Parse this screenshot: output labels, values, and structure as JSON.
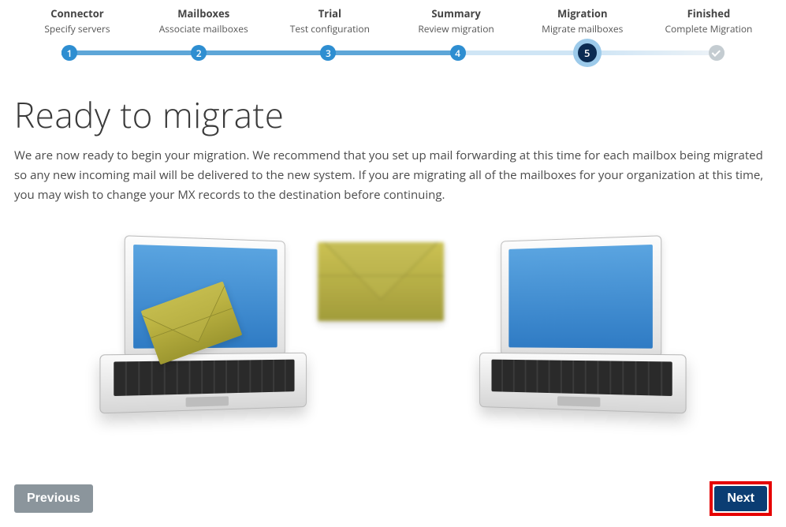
{
  "stepper": {
    "steps": [
      {
        "title": "Connector",
        "sub": "Specify servers",
        "num": "1",
        "state": "done"
      },
      {
        "title": "Mailboxes",
        "sub": "Associate mailboxes",
        "num": "2",
        "state": "done"
      },
      {
        "title": "Trial",
        "sub": "Test configuration",
        "num": "3",
        "state": "done"
      },
      {
        "title": "Summary",
        "sub": "Review migration",
        "num": "4",
        "state": "done"
      },
      {
        "title": "Migration",
        "sub": "Migrate mailboxes",
        "num": "5",
        "state": "current"
      },
      {
        "title": "Finished",
        "sub": "Complete Migration",
        "num": "",
        "state": "future"
      }
    ]
  },
  "headline": "Ready to migrate",
  "description": "We are now ready to begin your migration. We recommend that you set up mail forwarding at this time for each mailbox being migrated so any new incoming mail will be delivered to the new system. If you are migrating all of the mailboxes for your organization at this time, you may wish to change your MX records to the destination before continuing.",
  "buttons": {
    "previous": "Previous",
    "next": "Next"
  },
  "illustration": {
    "description": "Two laptops with blue screens exchanging a mail envelope; envelope emerges from left laptop and flies toward right laptop.",
    "icons": {
      "laptop_left": "laptop-icon",
      "laptop_right": "laptop-icon",
      "envelope_on_screen": "envelope-icon",
      "envelope_flying": "envelope-icon"
    }
  },
  "colors": {
    "step_done": "#2e8ed1",
    "step_current_bg": "#0b2b52",
    "step_halo": "#9ccaea",
    "step_future": "#c4ccd1",
    "primary_button": "#0b3d73",
    "secondary_button": "#8b959c",
    "highlight_border": "#e60000"
  }
}
